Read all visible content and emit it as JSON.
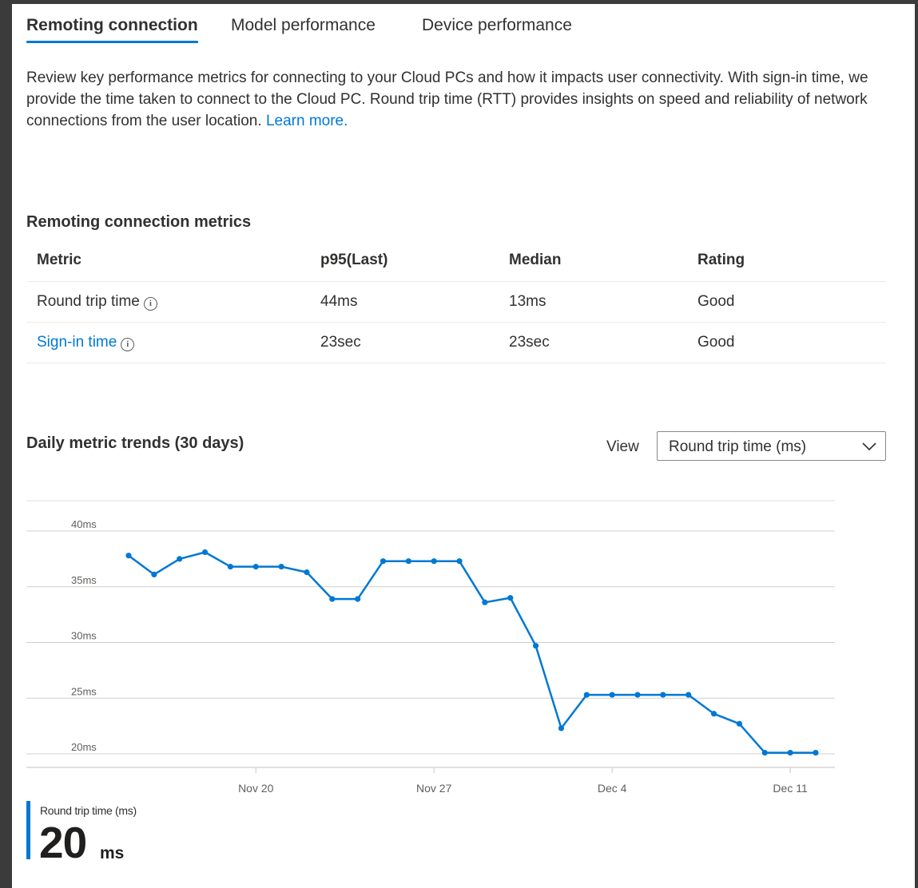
{
  "tabs": [
    {
      "label": "Remoting connection",
      "active": true
    },
    {
      "label": "Model performance",
      "active": false
    },
    {
      "label": "Device performance",
      "active": false
    }
  ],
  "intro": {
    "text": "Review key performance metrics for connecting to your Cloud PCs and how it impacts user connectivity. With sign-in time, we provide the time taken to connect to the Cloud PC. Round trip time (RTT) provides insights on speed and reliability of network connections from the user location.",
    "link": "Learn more."
  },
  "metrics": {
    "title": "Remoting connection metrics",
    "headers": [
      "Metric",
      "p95(Last)",
      "Median",
      "Rating"
    ],
    "rows": [
      {
        "metric": "Round trip time",
        "p95": "44ms",
        "median": "13ms",
        "rating": "Good",
        "is_link": false
      },
      {
        "metric": "Sign-in time",
        "p95": "23sec",
        "median": "23sec",
        "rating": "Good",
        "is_link": true
      }
    ]
  },
  "trends": {
    "title": "Daily metric trends (30 days)",
    "view_label": "View",
    "view_selected": "Round trip time (ms)"
  },
  "summary": {
    "label": "Round trip time (ms)",
    "value": "20",
    "unit": "ms"
  },
  "colors": {
    "accent": "#0078d4",
    "text": "#323130",
    "grid": "#d2d0ce"
  },
  "chart_data": {
    "type": "line",
    "x": [
      "Nov 15",
      "Nov 16",
      "Nov 17",
      "Nov 18",
      "Nov 19",
      "Nov 20",
      "Nov 21",
      "Nov 22",
      "Nov 23",
      "Nov 24",
      "Nov 25",
      "Nov 26",
      "Nov 27",
      "Nov 28",
      "Nov 29",
      "Nov 30",
      "Dec 1",
      "Dec 2",
      "Dec 3",
      "Dec 4",
      "Dec 5",
      "Dec 6",
      "Dec 7",
      "Dec 8",
      "Dec 9",
      "Dec 10",
      "Dec 11",
      "Dec 12"
    ],
    "series": [
      {
        "name": "Round trip time (ms)",
        "values": [
          37.8,
          36.1,
          37.5,
          38.1,
          36.8,
          36.8,
          36.8,
          36.3,
          33.9,
          33.9,
          37.3,
          37.3,
          37.3,
          37.3,
          33.6,
          34.0,
          29.7,
          22.3,
          25.3,
          25.3,
          25.3,
          25.3,
          25.3,
          23.6,
          22.7,
          20.1,
          20.1,
          20.1
        ]
      }
    ],
    "y_ticks": [
      "40ms",
      "35ms",
      "30ms",
      "25ms",
      "20ms"
    ],
    "y_tick_values": [
      40,
      35,
      30,
      25,
      20
    ],
    "x_ticks": [
      "Nov 20",
      "Nov 27",
      "Dec 4",
      "Dec 11"
    ],
    "ylim": [
      20,
      40
    ],
    "grid": true,
    "legend": "none"
  }
}
